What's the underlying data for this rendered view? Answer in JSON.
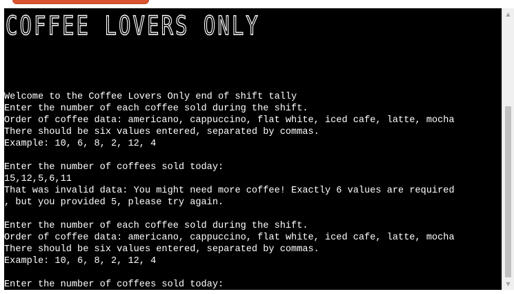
{
  "banner": {
    "text": "COFFEE LOVERS ONLY"
  },
  "terminal": {
    "lines": [
      "",
      "Welcome to the Coffee Lovers Only end of shift tally",
      "Enter the number of each coffee sold during the shift.",
      "Order of coffee data: americano, cappuccino, flat white, iced cafe, latte, mocha",
      "There should be six values entered, separated by commas.",
      "Example: 10, 6, 8, 2, 12, 4",
      "",
      "Enter the number of coffees sold today:",
      "15,12,5,6,11",
      "That was invalid data: You might need more coffee! Exactly 6 values are required",
      ", but you provided 5, please try again.",
      "",
      "Enter the number of each coffee sold during the shift.",
      "Order of coffee data: americano, cappuccino, flat white, iced cafe, latte, mocha",
      "There should be six values entered, separated by commas.",
      "Example: 10, 6, 8, 2, 12, 4",
      "",
      "Enter the number of coffees sold today:"
    ],
    "input_value": ""
  },
  "colors": {
    "background": "#000000",
    "text": "#ffffff",
    "run_button": "#d9552f",
    "scrollbar_track": "#f0f0f0",
    "scrollbar_thumb": "#c1c1c1"
  },
  "icons": {
    "scroll_up": "triangle-up-icon",
    "scroll_down": "triangle-down-icon"
  }
}
